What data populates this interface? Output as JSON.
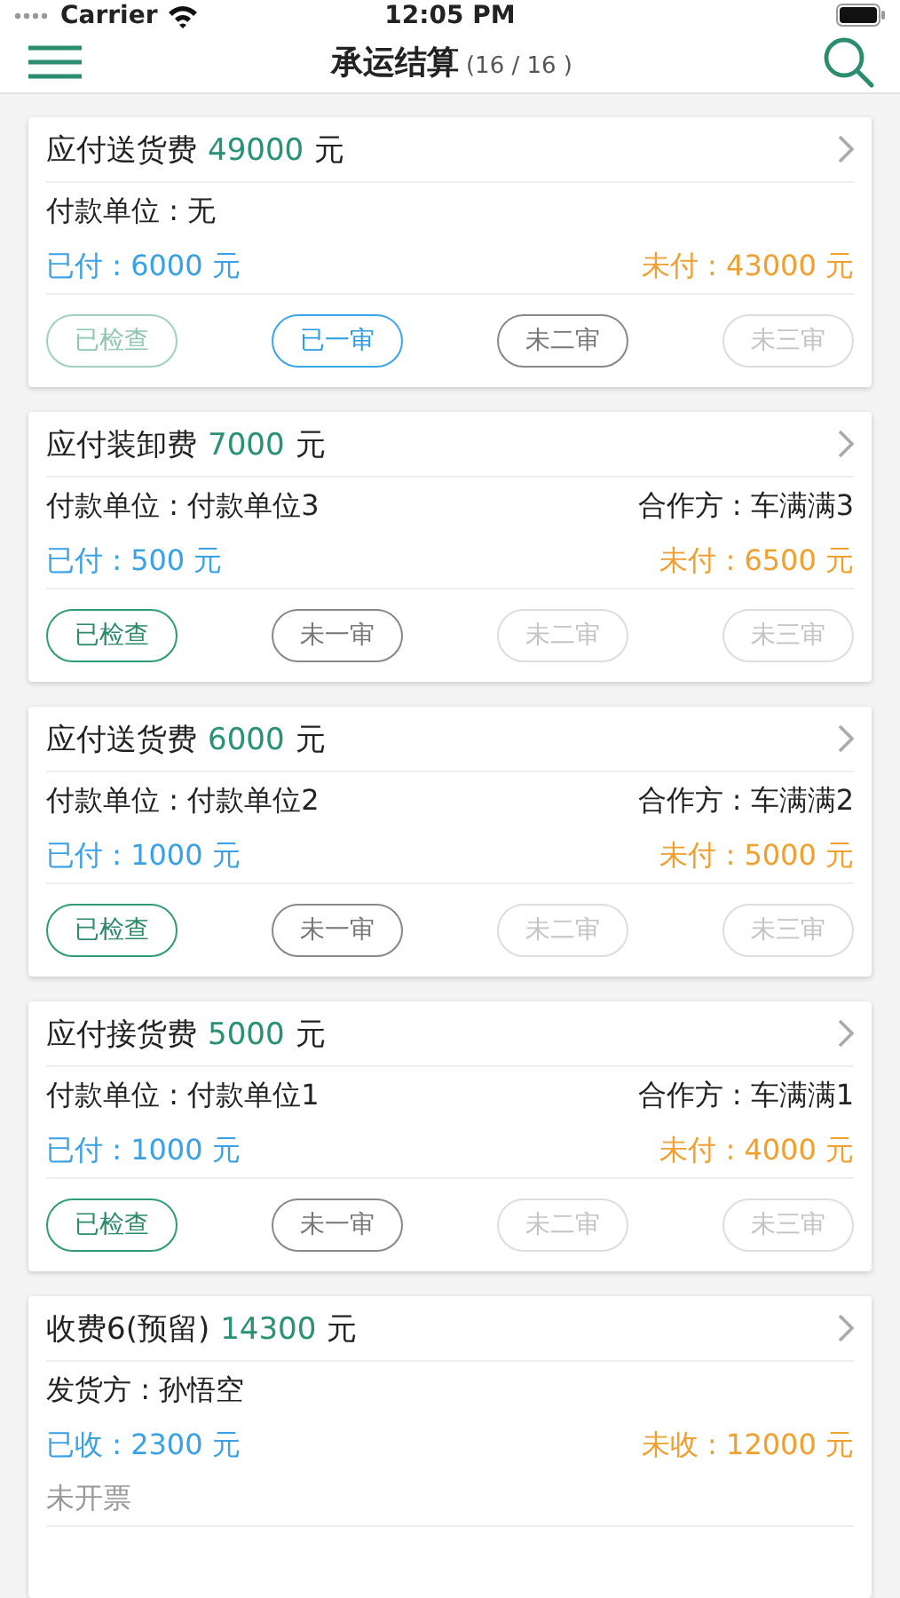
{
  "status_bar": {
    "carrier": "Carrier",
    "time": "12:05 PM"
  },
  "nav": {
    "title": "承运结算",
    "count": "(16 / 16 )"
  },
  "cards": [
    {
      "title": "应付送货费",
      "amount": "49000",
      "unit": "元",
      "left_info": "付款单位 : 无",
      "paid": "已付 : 6000 元",
      "unpaid": "未付 : 43000 元",
      "steps": [
        {
          "label": "已检查",
          "kind": "faded"
        },
        {
          "label": "已一审",
          "kind": "blue"
        },
        {
          "label": "未二审",
          "kind": "grey"
        },
        {
          "label": "未三审",
          "kind": "light"
        }
      ]
    },
    {
      "title": "应付装卸费",
      "amount": "7000",
      "unit": "元",
      "left_info": "付款单位 : 付款单位3",
      "right_info": "合作方 : 车满满3",
      "paid": "已付 : 500 元",
      "unpaid": "未付 : 6500 元",
      "steps": [
        {
          "label": "已检查",
          "kind": "green"
        },
        {
          "label": "未一审",
          "kind": "grey"
        },
        {
          "label": "未二审",
          "kind": "light"
        },
        {
          "label": "未三审",
          "kind": "light"
        }
      ]
    },
    {
      "title": "应付送货费",
      "amount": "6000",
      "unit": "元",
      "left_info": "付款单位 : 付款单位2",
      "right_info": "合作方 : 车满满2",
      "paid": "已付 : 1000 元",
      "unpaid": "未付 : 5000 元",
      "steps": [
        {
          "label": "已检查",
          "kind": "green"
        },
        {
          "label": "未一审",
          "kind": "grey"
        },
        {
          "label": "未二审",
          "kind": "light"
        },
        {
          "label": "未三审",
          "kind": "light"
        }
      ]
    },
    {
      "title": "应付接货费",
      "amount": "5000",
      "unit": "元",
      "left_info": "付款单位 : 付款单位1",
      "right_info": "合作方 : 车满满1",
      "paid": "已付 : 1000 元",
      "unpaid": "未付 : 4000 元",
      "steps": [
        {
          "label": "已检查",
          "kind": "green"
        },
        {
          "label": "未一审",
          "kind": "grey"
        },
        {
          "label": "未二审",
          "kind": "light"
        },
        {
          "label": "未三审",
          "kind": "light"
        }
      ]
    },
    {
      "title": "收费6(预留)",
      "amount": "14300",
      "unit": "元",
      "left_info": "发货方 : 孙悟空",
      "paid": "已收 : 2300 元",
      "unpaid": "未收 : 12000 元",
      "note": "未开票"
    }
  ]
}
